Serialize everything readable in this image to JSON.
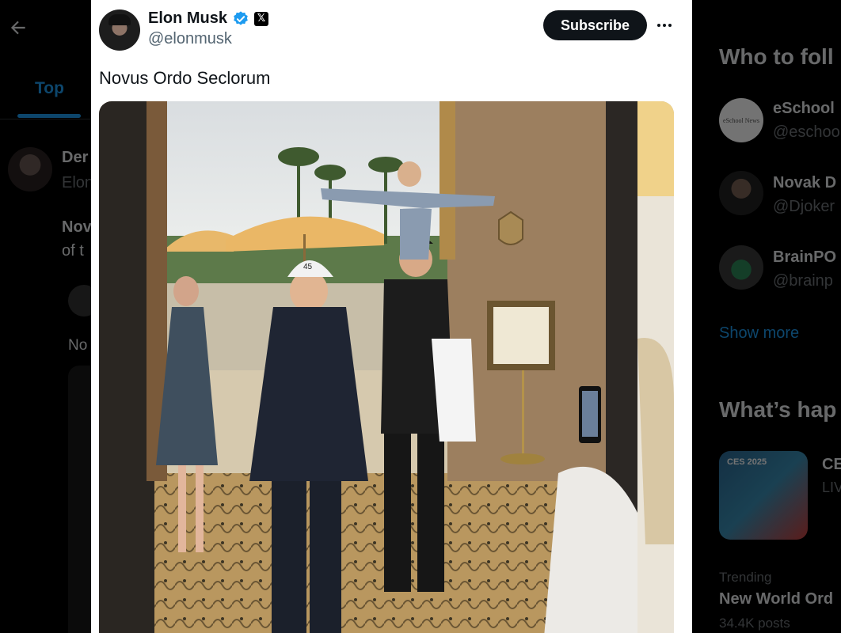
{
  "background": {
    "tab_top": "Top",
    "post": {
      "name": "Der",
      "handle": "Elon",
      "text_line1": "Nov",
      "text_line2": "of t",
      "reply_text": "No"
    },
    "sidebar": {
      "who_to_follow_title": "Who to foll",
      "accounts": [
        {
          "name": "eSchool",
          "handle": "@eschoo",
          "logo_text": "eSchool News"
        },
        {
          "name": "Novak D",
          "handle": "@Djoker"
        },
        {
          "name": "BrainPO",
          "handle": "@brainp"
        }
      ],
      "show_more": "Show more",
      "whats_happening_title": "What’s hap",
      "event": {
        "thumb_label": "CES 2025",
        "title": "CE",
        "subtitle": "LIV"
      },
      "trend": {
        "label": "Trending",
        "name": "New World Ord",
        "count": "34.4K posts"
      }
    }
  },
  "tweet": {
    "author_name": "Elon Musk",
    "author_handle": "@elonmusk",
    "x_badge": "𝕏",
    "subscribe_label": "Subscribe",
    "text": "Novus Ordo Seclorum",
    "photo": {
      "cap_text": "45",
      "framed_document": "certificate"
    }
  },
  "colors": {
    "accent": "#1d9bf0",
    "subscribe_bg": "#0f1419",
    "card_bg": "#ffffff"
  },
  "icons": {
    "back": "back-arrow-icon",
    "verified": "verified-badge-icon",
    "more": "more-horizontal-icon"
  }
}
